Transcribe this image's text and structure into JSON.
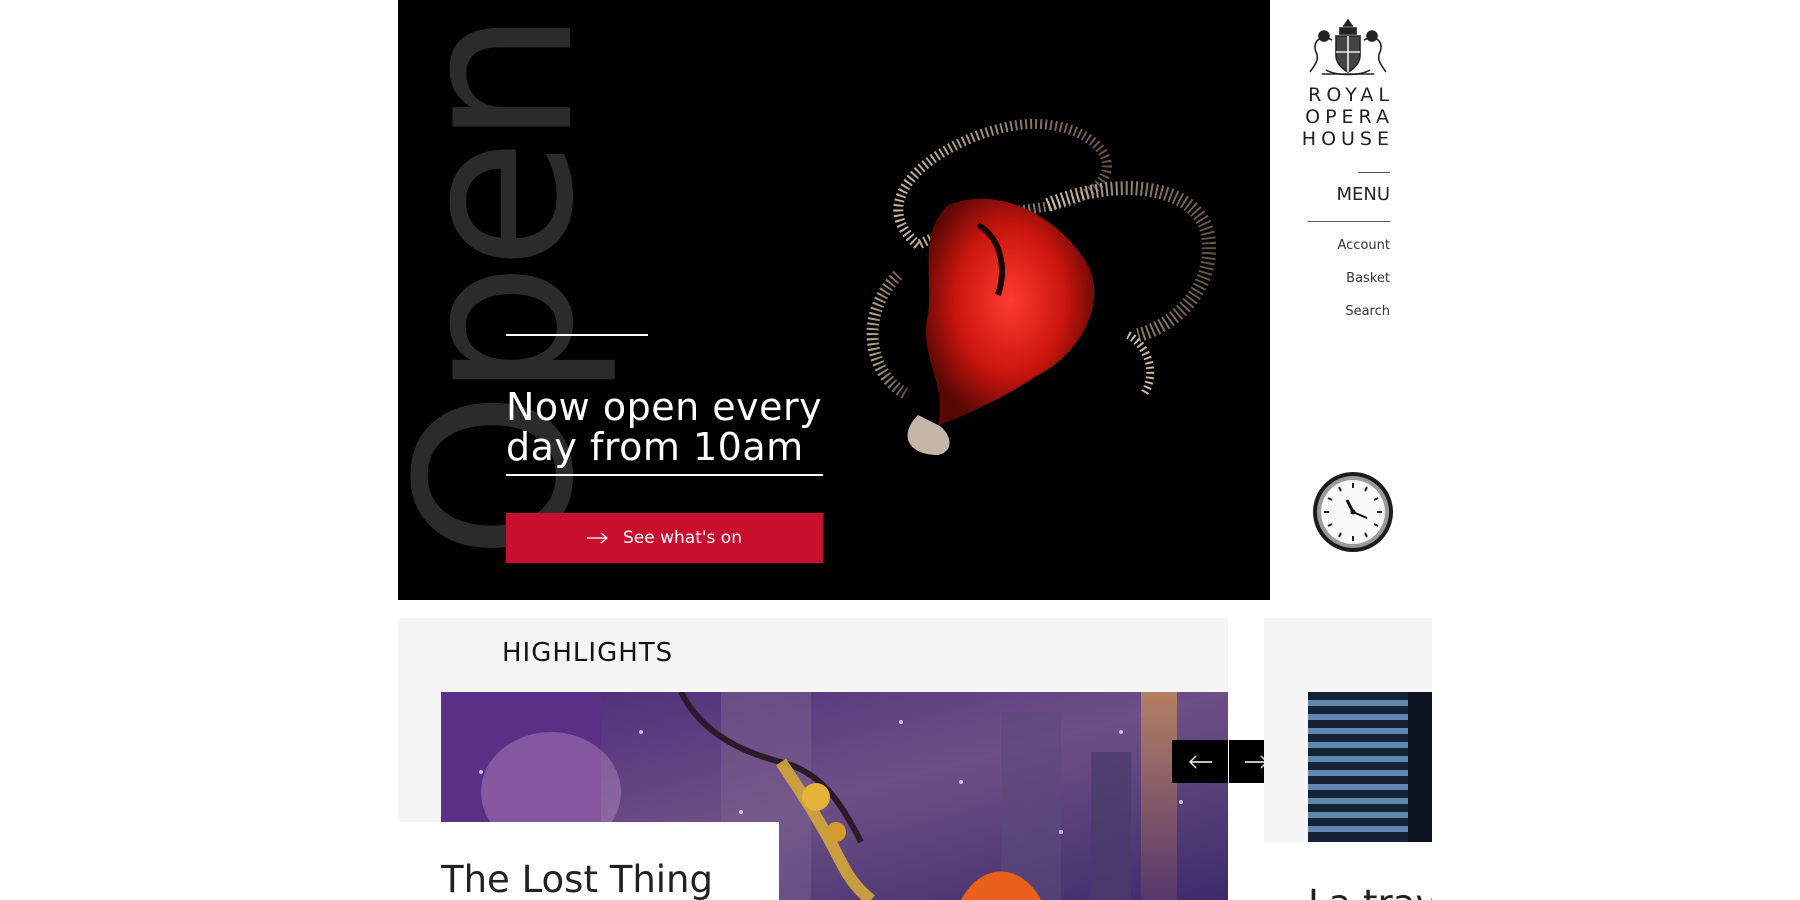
{
  "hero": {
    "background_word": "Open",
    "headline": "Now open every day from 10am",
    "cta_label": "See what's on"
  },
  "brand": {
    "lines": [
      "ROYAL",
      "OPERA",
      "HOUSE"
    ]
  },
  "nav": {
    "menu_label": "MENU",
    "links": [
      "Account",
      "Basket",
      "Search"
    ]
  },
  "highlights": {
    "heading": "HIGHLIGHTS",
    "cards": [
      {
        "title": "The Lost Thing"
      },
      {
        "title": "La trav"
      }
    ]
  },
  "colors": {
    "accent": "#c8102e",
    "hero_bg": "#000000",
    "panel_bg": "#f5f5f5"
  },
  "icons": {
    "cta": "arrow-right-icon",
    "prev": "arrow-left-icon",
    "next": "arrow-right-icon",
    "crest": "royal-crest-icon",
    "sponsor": "rolex-clock-icon"
  }
}
